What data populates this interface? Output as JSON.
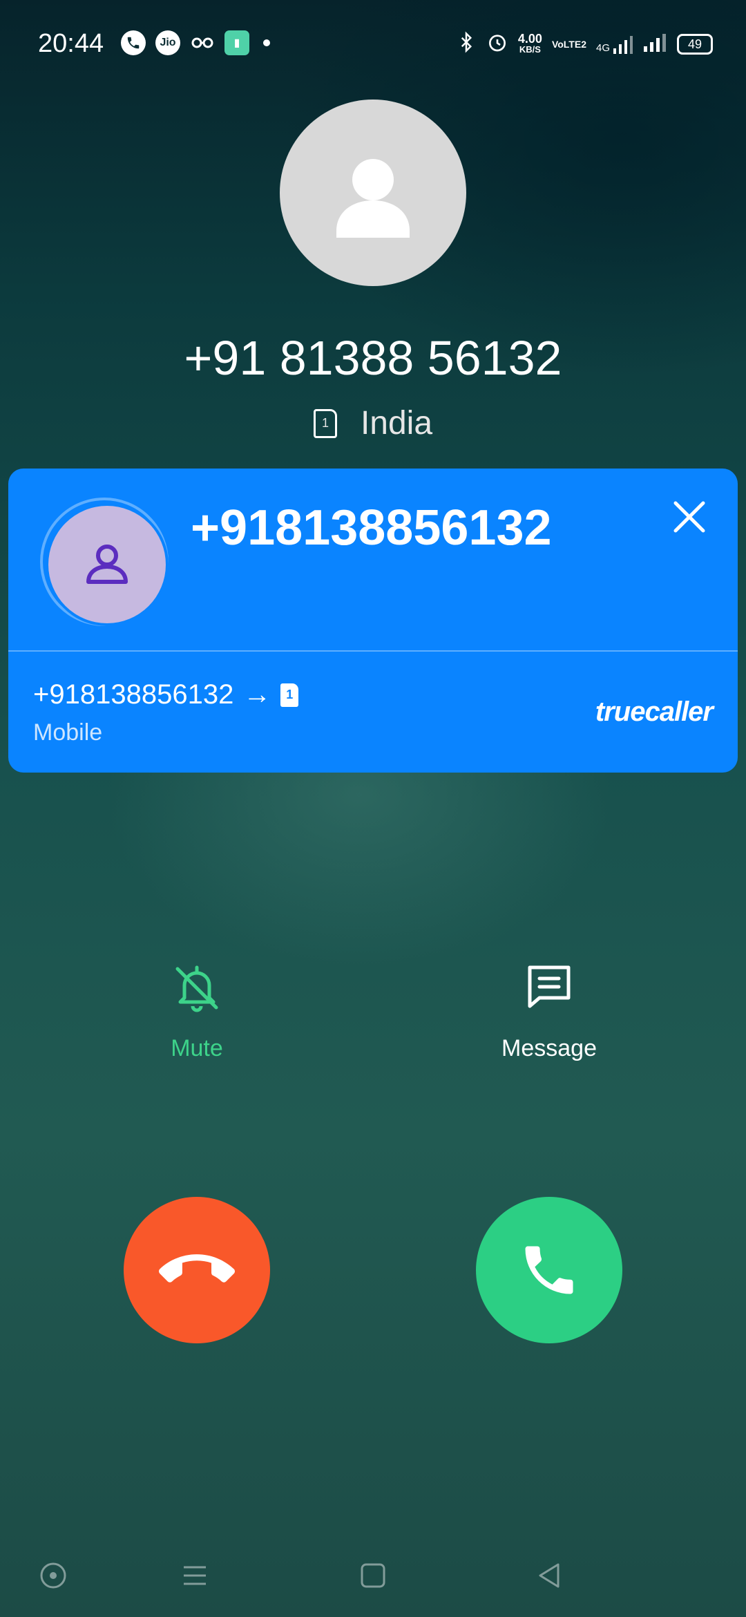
{
  "status_bar": {
    "time": "20:44",
    "left_icons": [
      "phone-icon",
      "jio-icon",
      "glasses-icon",
      "app-icon",
      "dot"
    ],
    "jio_text": "Jio",
    "speed_value": "4.00",
    "speed_unit": "KB/S",
    "volte": "VoLTE2",
    "network": "4G",
    "battery": "49"
  },
  "caller": {
    "number": "+91 81388 56132",
    "location": "India",
    "sim_slot": "1"
  },
  "truecaller": {
    "number": "+918138856132",
    "route_number": "+918138856132",
    "arrow": "→",
    "sim_slot": "1",
    "type": "Mobile",
    "brand": "truecaller",
    "color": "#0a84ff"
  },
  "actions": {
    "mute_label": "Mute",
    "message_label": "Message"
  },
  "colors": {
    "decline": "#f9582a",
    "accept": "#2ccf84",
    "mute_active": "#3dd38a"
  }
}
